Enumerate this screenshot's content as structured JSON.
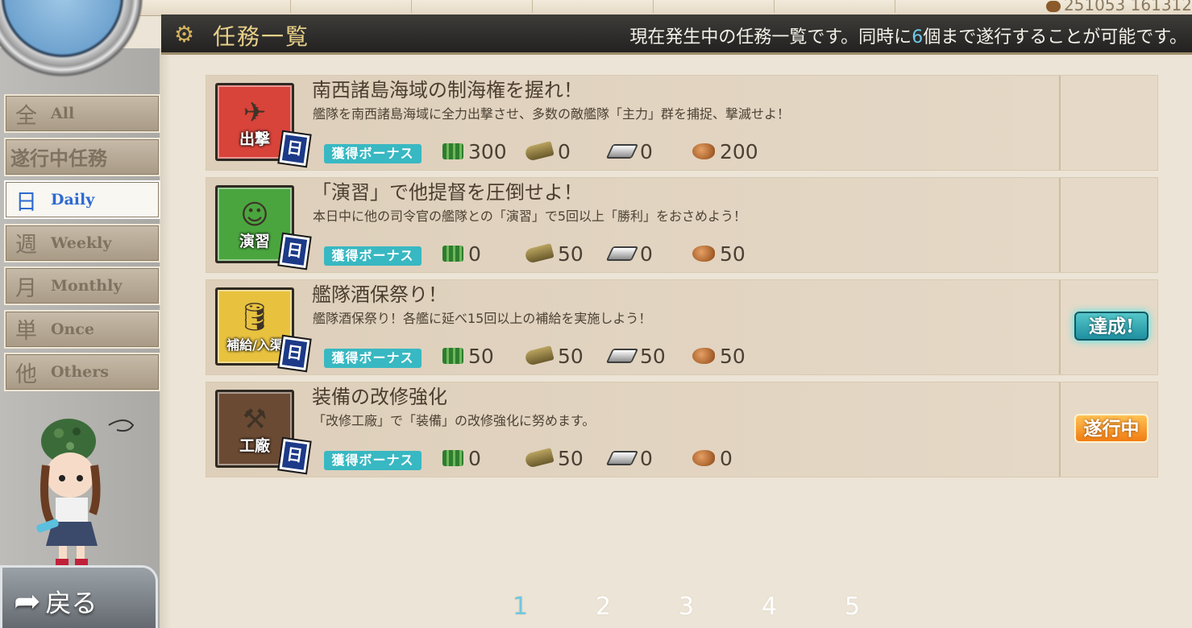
{
  "header": {
    "top_resources": "251053   161312",
    "title": "任務一覧",
    "desc_prefix": "現在発生中の任務一覧です。同時に",
    "desc_number": "6",
    "desc_suffix": "個まで遂行することが可能です。"
  },
  "sidebar": {
    "items": [
      {
        "kanji": "全",
        "label": "All"
      },
      {
        "kanji": "",
        "label": "遂行中任務"
      },
      {
        "kanji": "日",
        "label": "Daily"
      },
      {
        "kanji": "週",
        "label": "Weekly"
      },
      {
        "kanji": "月",
        "label": "Monthly"
      },
      {
        "kanji": "単",
        "label": "Once"
      },
      {
        "kanji": "他",
        "label": "Others"
      }
    ],
    "back_label": "戻る"
  },
  "quests": [
    {
      "icon_label": "出撃",
      "icon_color": "#d8433a",
      "category": "日",
      "title": "南西諸島海域の制海権を握れ！",
      "desc": "艦隊を南西諸島海域に全力出撃させ、多数の敵艦隊「主力」群を捕捉、撃滅せよ！",
      "bonus": "獲得ボーナス",
      "fuel": "300",
      "ammo": "0",
      "steel": "0",
      "bauxite": "200",
      "status": ""
    },
    {
      "icon_label": "演習",
      "icon_color": "#4aa53f",
      "category": "日",
      "title": "「演習」で他提督を圧倒せよ！",
      "desc": "本日中に他の司令官の艦隊との「演習」で5回以上「勝利」をおさめよう！",
      "bonus": "獲得ボーナス",
      "fuel": "0",
      "ammo": "50",
      "steel": "0",
      "bauxite": "50",
      "status": ""
    },
    {
      "icon_label": "補給/入渠",
      "icon_color": "#e8c23f",
      "category": "日",
      "title": "艦隊酒保祭り！",
      "desc": "艦隊酒保祭り！各艦に延べ15回以上の補給を実施しよう！",
      "bonus": "獲得ボーナス",
      "fuel": "50",
      "ammo": "50",
      "steel": "50",
      "bauxite": "50",
      "status": "達成!"
    },
    {
      "icon_label": "工廠",
      "icon_color": "#6b4a33",
      "category": "日",
      "title": "装備の改修強化",
      "desc": "「改修工廠」で「装備」の改修強化に努めます。",
      "bonus": "獲得ボーナス",
      "fuel": "0",
      "ammo": "50",
      "steel": "0",
      "bauxite": "0",
      "status": "遂行中"
    }
  ],
  "pagination": [
    "1",
    "2",
    "3",
    "4",
    "5"
  ]
}
